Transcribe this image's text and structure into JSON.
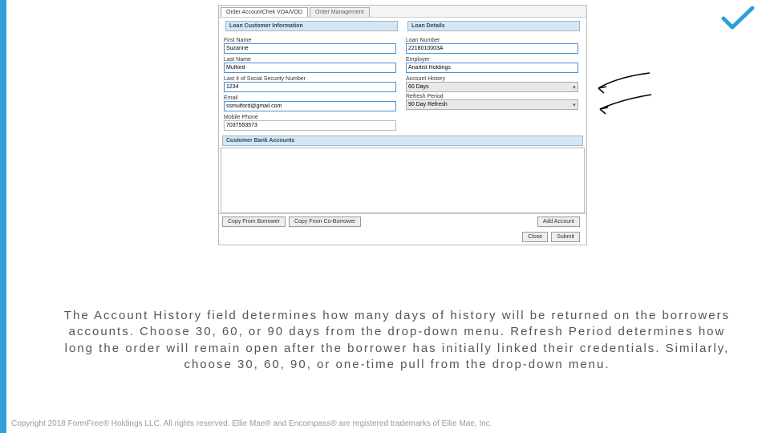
{
  "tabs": {
    "active": "Order AccountChek VOA/VOD",
    "inactive": "Order Management"
  },
  "sections": {
    "customer": "Loan Customer Information",
    "details": "Loan Details",
    "bank": "Customer Bank Accounts"
  },
  "customer": {
    "first_label": "First Name",
    "first": "Suzanne",
    "last_label": "Last Name",
    "last": "Mulford",
    "ssn_label": "Last 4 of Social Security Number",
    "ssn": "1234",
    "email_label": "Email",
    "email": "ssmulford@gmail.com",
    "phone_label": "Mobile Phone",
    "phone": "7037553573"
  },
  "details": {
    "loan_label": "Loan Number",
    "loan": "2218010003A",
    "employer_label": "Employer",
    "employer": "Anartist Holdings",
    "history_label": "Account History",
    "history": "60 Days",
    "refresh_label": "Refresh Period",
    "refresh": "90 Day Refresh"
  },
  "buttons": {
    "copy_borrower": "Copy From Borrower",
    "copy_co": "Copy From Co-Borrower",
    "add": "Add Account",
    "close": "Close",
    "submit": "Submit"
  },
  "caption": "The Account History field determines how many days of history will be returned on the borrowers accounts. Choose 30, 60, or 90 days from the drop-down menu. Refresh Period determines how long the order will remain open after the borrower has initially linked their credentials. Similarly, choose 30, 60, 90, or one-time pull from the drop-down menu.",
  "copyright": "Copyright 2018 FormFree® Holdings LLC. All rights reserved. Ellie Mae® and Encompass® are registered trademarks of Ellie Mae, Inc."
}
